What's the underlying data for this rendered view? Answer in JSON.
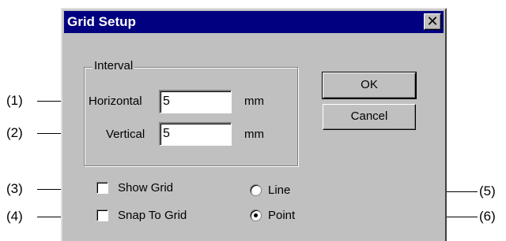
{
  "dialog": {
    "title": "Grid Setup",
    "close_glyph": "✕",
    "interval_group": {
      "label": "Interval",
      "horizontal": {
        "label": "Horizontal",
        "value": "5",
        "unit": "mm"
      },
      "vertical": {
        "label": "Vertical",
        "value": "5",
        "unit": "mm"
      }
    },
    "buttons": {
      "ok": "OK",
      "cancel": "Cancel"
    },
    "options": {
      "show_grid": {
        "label": "Show Grid",
        "checked": false
      },
      "snap_to_grid": {
        "label": "Snap To Grid",
        "checked": false
      },
      "line": {
        "label": "Line",
        "selected": false
      },
      "point": {
        "label": "Point",
        "selected": true
      }
    }
  },
  "callouts": [
    "(1)",
    "(2)",
    "(3)",
    "(4)",
    "(5)",
    "(6)"
  ],
  "colors": {
    "titlebar": "#000080",
    "face": "#c0c0c0"
  }
}
